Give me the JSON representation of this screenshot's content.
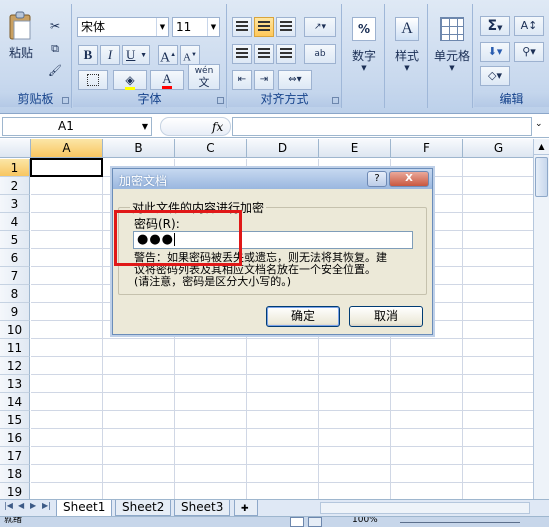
{
  "ribbon": {
    "clipboard": {
      "paste_label": "粘贴",
      "group_label": "剪贴板"
    },
    "font": {
      "font_name": "宋体",
      "font_size": "11",
      "bold": "B",
      "italic": "I",
      "underline": "U",
      "grow": "A",
      "shrink": "A",
      "font_color_letter": "A",
      "wen": "wén",
      "wen2": "文",
      "group_label": "字体"
    },
    "alignment": {
      "group_label": "对齐方式",
      "wrap_label": "ab"
    },
    "number": {
      "label": "数字",
      "percent": "%"
    },
    "styles": {
      "label": "样式"
    },
    "cells": {
      "label": "单元格"
    },
    "editing": {
      "group_label": "编辑",
      "sum": "Σ"
    }
  },
  "formula_bar": {
    "cell_ref": "A1",
    "fx": "fx",
    "formula": ""
  },
  "columns": [
    "A",
    "B",
    "C",
    "D",
    "E",
    "F",
    "G"
  ],
  "rows": [
    "1",
    "2",
    "3",
    "4",
    "5",
    "6",
    "7",
    "8",
    "9",
    "10",
    "11",
    "12",
    "13",
    "14",
    "15",
    "16",
    "17",
    "18",
    "19"
  ],
  "sheets": [
    "Sheet1",
    "Sheet2",
    "Sheet3"
  ],
  "status": {
    "mode": "就绪",
    "zoom": "100%"
  },
  "dialog": {
    "title": "加密文档",
    "help": "?",
    "close": "X",
    "group_label": "对此文件的内容进行加密",
    "password_label": "密码(R):",
    "password_mask": "●●●",
    "warning_line1": "警告：如果密码被丢失或遗忘，则无法将其恢复。建",
    "warning_line2": "议将密码列表及其相应文档名放在一个安全位置。",
    "warning_line3": "(请注意，密码是区分大小写的。)",
    "ok": "确定",
    "cancel": "取消"
  },
  "colors": {
    "highlight_box": "#e01818",
    "selected_header": "#f8c661"
  }
}
